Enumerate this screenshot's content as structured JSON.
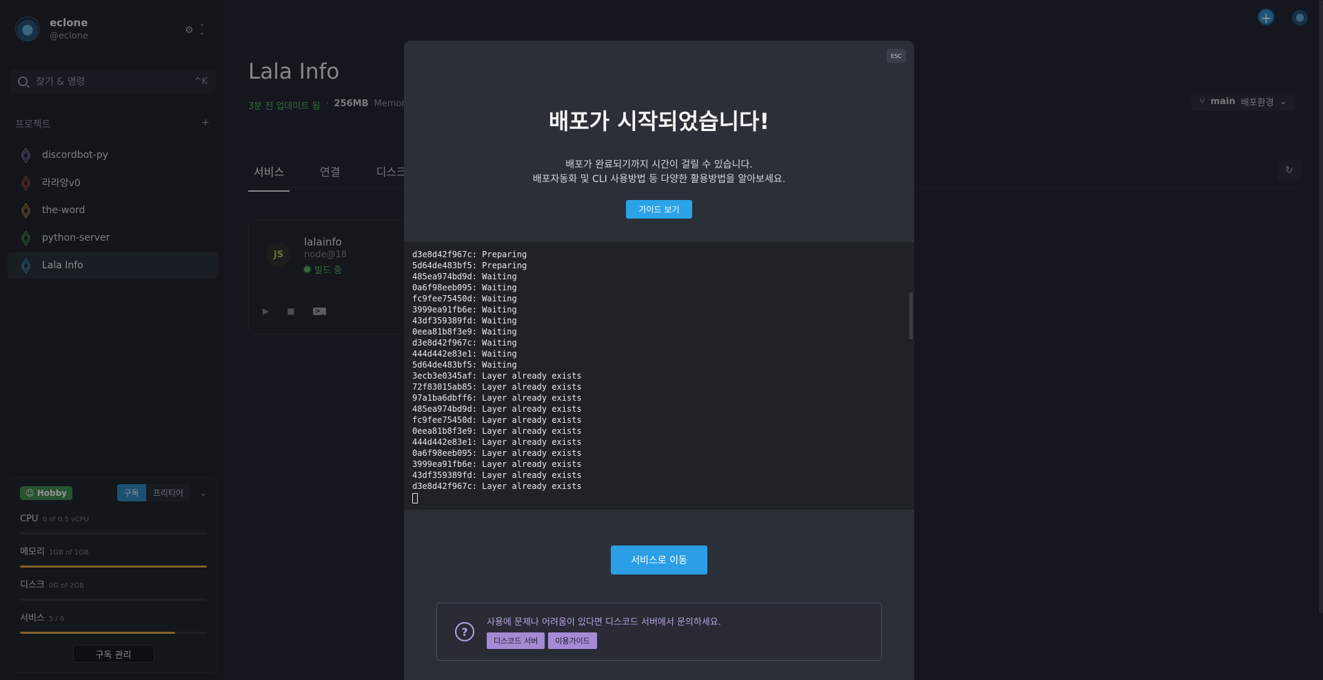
{
  "user": {
    "name": "eclone",
    "handle": "@eclone"
  },
  "search": {
    "placeholder": "찾기 & 명령",
    "shortcut": "^K"
  },
  "projects": {
    "heading": "프로젝트",
    "add": "+",
    "items": [
      {
        "label": "discordbot-py",
        "color": "#8d8fc6"
      },
      {
        "label": "라라앙v0",
        "color": "#d04a4a"
      },
      {
        "label": "the-word",
        "color": "#d8a034"
      },
      {
        "label": "python-server",
        "color": "#4caf50"
      },
      {
        "label": "Lala Info",
        "color": "#4ba6d8"
      }
    ]
  },
  "plan": {
    "badge": "Hobby",
    "seg_on": "구독",
    "seg_off": "프리티어",
    "metrics": [
      {
        "label": "CPU",
        "sub": "0 of 0.5 vCPU",
        "fill": 0
      },
      {
        "label": "메모리",
        "sub": "1GB of 1GB",
        "fill": 1.0
      },
      {
        "label": "디스크",
        "sub": "0G of 2GB",
        "fill": 0
      },
      {
        "label": "서비스",
        "sub": "5 / 6",
        "fill": 0.83
      }
    ],
    "manage_label": "구독 관리"
  },
  "page": {
    "title": "Lala Info",
    "updated": "3분 전 업데이트 됨",
    "sep": "·",
    "memory_value": "256MB",
    "memory_label": "Memory",
    "branch": "main",
    "branch_suffix": "배포환경",
    "tabs": [
      "서비스",
      "연결",
      "디스크"
    ]
  },
  "service": {
    "logo": "JS",
    "name": "lalainfo",
    "runtime": "node@18",
    "status": "빌드 중",
    "status_color": "#57b560"
  },
  "modal": {
    "esc": "ESC",
    "title": "배포가 시작되었습니다!",
    "desc1": "배포가 완료되기까지 시간이 걸릴 수 있습니다.",
    "desc2": "배포자동화 및 CLI 사용방법 등 다양한 활용방법을 알아보세요.",
    "guide_button": "가이드 보기",
    "log": [
      "d3e8d42f967c: Preparing",
      "5d64de483bf5: Preparing",
      "485ea974bd9d: Waiting",
      "0a6f98eeb095: Waiting",
      "fc9fee75450d: Waiting",
      "3999ea91fb6e: Waiting",
      "43df359389fd: Waiting",
      "0eea81b8f3e9: Waiting",
      "d3e8d42f967c: Waiting",
      "444d442e83e1: Waiting",
      "5d64de483bf5: Waiting",
      "3ecb3e0345af: Layer already exists",
      "72f83015ab85: Layer already exists",
      "97a1ba6dbff6: Layer already exists",
      "485ea974bd9d: Layer already exists",
      "fc9fee75450d: Layer already exists",
      "0eea81b8f3e9: Layer already exists",
      "444d442e83e1: Layer already exists",
      "0a6f98eeb095: Layer already exists",
      "3999ea91fb6e: Layer already exists",
      "43df359389fd: Layer already exists",
      "d3e8d42f967c: Layer already exists"
    ],
    "go_button": "서비스로 이동",
    "help_text": "사용에 문제나 어려움이 있다면 디스코드 서버에서 문의하세요.",
    "help_buttons": [
      "디스코드 서버",
      "이용가이드"
    ]
  },
  "icons": {
    "settings": "gear-icon",
    "expand": "chevron-updown-icon",
    "search": "search-icon",
    "project": "layers-icon",
    "branch": "git-branch-icon",
    "refresh": "refresh-icon",
    "help": "question-icon"
  }
}
